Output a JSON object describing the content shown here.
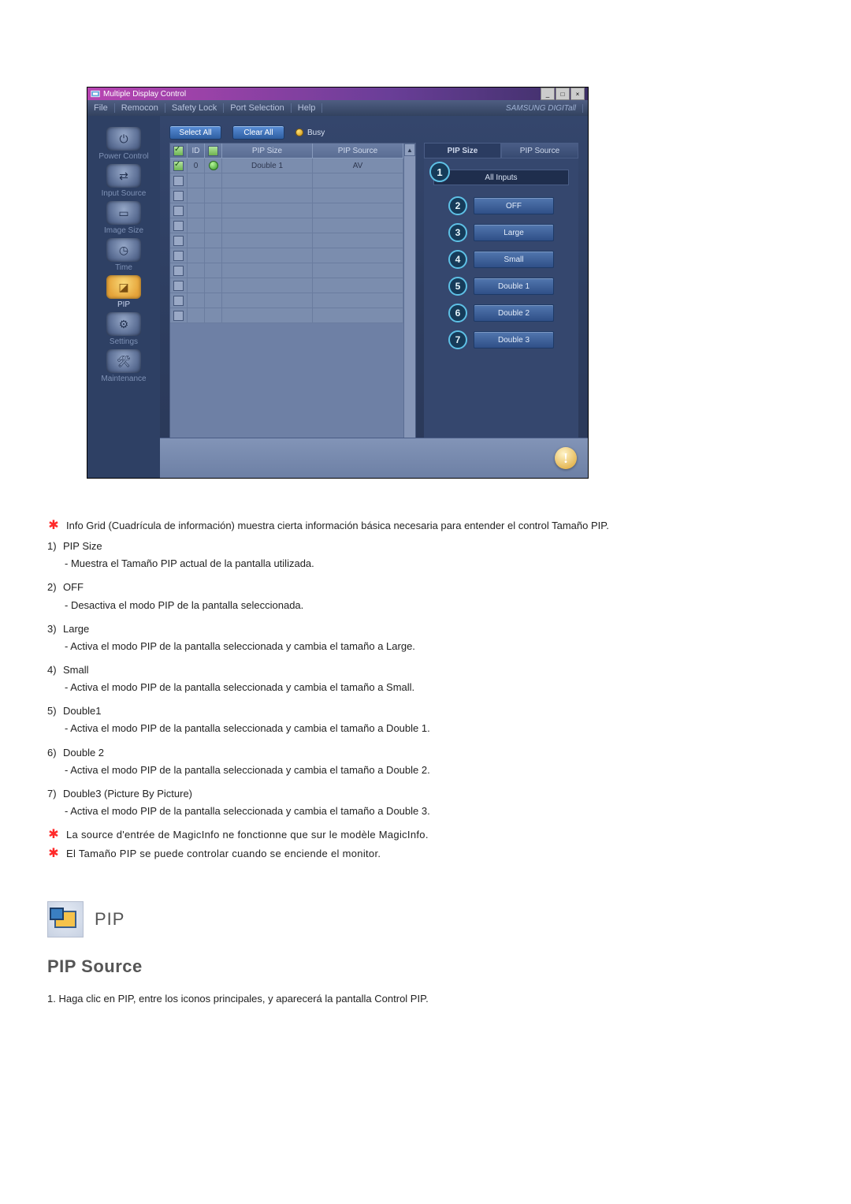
{
  "app": {
    "title": "Multiple Display Control",
    "menus": [
      "File",
      "Remocon",
      "Safety Lock",
      "Port Selection",
      "Help"
    ],
    "brand": "SAMSUNG DIGITall"
  },
  "sidebar": {
    "items": [
      {
        "label": "Power Control"
      },
      {
        "label": "Input Source"
      },
      {
        "label": "Image Size"
      },
      {
        "label": "Time"
      },
      {
        "label": "PIP"
      },
      {
        "label": "Settings"
      },
      {
        "label": "Maintenance"
      }
    ]
  },
  "toolbar": {
    "select_all": "Select All",
    "clear_all": "Clear All",
    "busy_label": "Busy"
  },
  "grid": {
    "headers": {
      "chk": "✔",
      "id": "ID",
      "status": "",
      "size": "PIP Size",
      "source": "PIP Source"
    },
    "row0": {
      "id": "0",
      "size": "Double 1",
      "source": "AV"
    }
  },
  "panel": {
    "tabs": {
      "size": "PIP Size",
      "source": "PIP Source"
    },
    "marker1": "1",
    "subtitle": "All Inputs",
    "options": [
      {
        "num": "2",
        "label": "OFF"
      },
      {
        "num": "3",
        "label": "Large"
      },
      {
        "num": "4",
        "label": "Small"
      },
      {
        "num": "5",
        "label": "Double 1"
      },
      {
        "num": "6",
        "label": "Double 2"
      },
      {
        "num": "7",
        "label": "Double 3"
      }
    ]
  },
  "doc": {
    "intro": "Info Grid (Cuadrícula de información) muestra cierta información básica necesaria para entender el control Tamaño PIP.",
    "items": [
      {
        "n": "1)",
        "t": "PIP Size",
        "d": "- Muestra el Tamaño PIP actual de la pantalla utilizada."
      },
      {
        "n": "2)",
        "t": "OFF",
        "d": "- Desactiva el modo PIP de la pantalla seleccionada."
      },
      {
        "n": "3)",
        "t": "Large",
        "d": "- Activa el modo PIP de la pantalla seleccionada y cambia el tamaño a Large."
      },
      {
        "n": "4)",
        "t": "Small",
        "d": "- Activa el modo PIP de la pantalla seleccionada y cambia el tamaño a Small."
      },
      {
        "n": "5)",
        "t": "Double1",
        "d": "- Activa el modo PIP de la pantalla seleccionada y cambia el tamaño a Double 1."
      },
      {
        "n": "6)",
        "t": "Double 2",
        "d": "- Activa el modo PIP de la pantalla seleccionada y cambia el tamaño a Double 2."
      },
      {
        "n": "7)",
        "t": "Double3 (Picture By Picture)",
        "d": "- Activa el modo PIP de la pantalla seleccionada y cambia el tamaño a Double 3."
      }
    ],
    "note1": "La source d'entrée de MagicInfo ne fonctionne que sur le modèle MagicInfo.",
    "note2": "El Tamaño PIP se puede controlar cuando se enciende el monitor.",
    "pip_label": "PIP",
    "section_h": "PIP Source",
    "step1": "1.  Haga clic en PIP, entre los iconos principales, y aparecerá la pantalla Control PIP."
  }
}
